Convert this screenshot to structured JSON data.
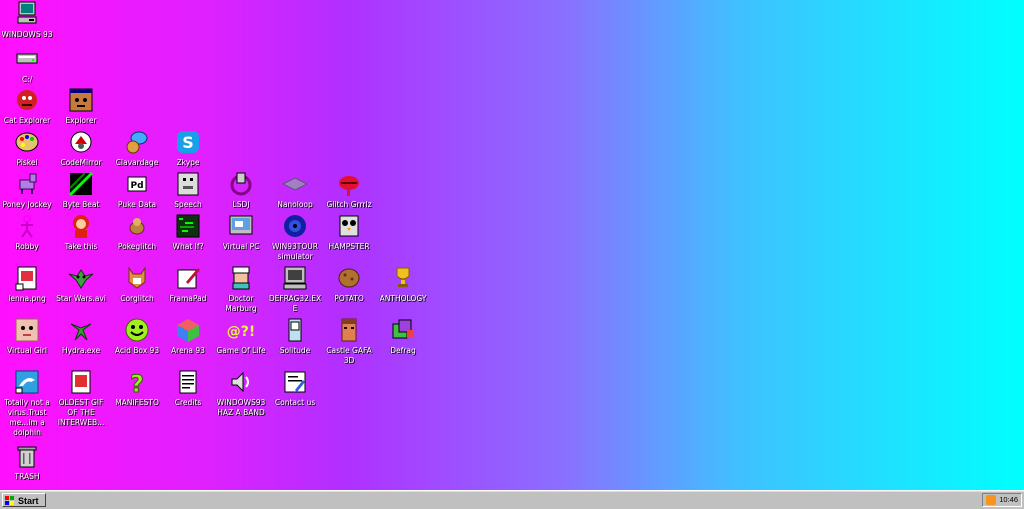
{
  "desktop": {
    "icons": [
      {
        "label": "WINDOWS 93"
      },
      {
        "label": "C:/"
      },
      {
        "label": "Cat Explorer"
      },
      {
        "label": "Explorer"
      },
      {
        "label": "Piskel"
      },
      {
        "label": "CodeMirror"
      },
      {
        "label": "Clavardage"
      },
      {
        "label": "Zkype"
      },
      {
        "label": "Poney Jockey"
      },
      {
        "label": "Byte Beat"
      },
      {
        "label": "Puke Data"
      },
      {
        "label": "Speech"
      },
      {
        "label": "LSDJ"
      },
      {
        "label": "Nanoloop"
      },
      {
        "label": "Glitch Grrrlz"
      },
      {
        "label": "Robby"
      },
      {
        "label": "Take this"
      },
      {
        "label": "Pokeglitch"
      },
      {
        "label": "What If?"
      },
      {
        "label": "Virtual PC"
      },
      {
        "label": "WIN93TOUR simulator"
      },
      {
        "label": "HAMPSTER"
      },
      {
        "label": "lenna.png"
      },
      {
        "label": "Star Wars.avi"
      },
      {
        "label": "Corglitch"
      },
      {
        "label": "FramaPad"
      },
      {
        "label": "Doctor Marburg"
      },
      {
        "label": "DEFRAG32.EXE"
      },
      {
        "label": "POTATO"
      },
      {
        "label": "ANTHOLOGY"
      },
      {
        "label": "Virtual Girl"
      },
      {
        "label": "Hydra.exe"
      },
      {
        "label": "Acid Box 93"
      },
      {
        "label": "Arena 93"
      },
      {
        "label": "Game Of Life"
      },
      {
        "label": "Solitude"
      },
      {
        "label": "Castle GAFA 3D"
      },
      {
        "label": "Defrag"
      },
      {
        "label": "Totally not a virus.Trust me...im a dolphin"
      },
      {
        "label": "OLDEST GIF OF THE INTERWEB..."
      },
      {
        "label": "MANIFESTO"
      },
      {
        "label": "Credits"
      },
      {
        "label": "WINDOWS93 HAZ A BAND"
      },
      {
        "label": "Contact us"
      },
      {
        "label": "TRASH"
      }
    ]
  },
  "taskbar": {
    "start_label": "Start",
    "clock": "10:46"
  },
  "colors": {
    "gradient_left": "#ff10ff",
    "gradient_right": "#00ffff",
    "taskbar": "#c0c0c0"
  }
}
